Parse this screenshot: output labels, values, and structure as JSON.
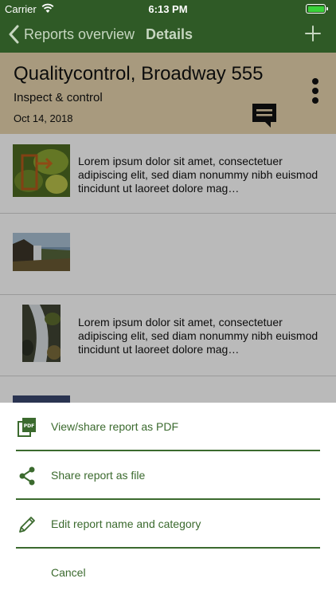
{
  "status_bar": {
    "carrier": "Carrier",
    "time": "6:13 PM",
    "battery_color": "#39d239"
  },
  "nav": {
    "back_label": "Reports overview",
    "title": "Details",
    "add_icon": "plus-icon"
  },
  "report": {
    "title": "Qualitycontrol, Broadway 555",
    "category": "Inspect & control",
    "date": "Oct 14, 2018"
  },
  "entries": [
    {
      "image": "photo-leaf-arrow",
      "text": "Lorem ipsum dolor sit amet, consectetuer adipiscing elit, sed diam nonummy nibh euismod tincidunt ut laoreet dolore mag…"
    },
    {
      "image": "photo-waterfall-landscape",
      "text": ""
    },
    {
      "image": "photo-waterfall-stream",
      "text": "Lorem ipsum dolor sit amet, consectetuer adipiscing elit, sed diam nonummy nibh euismod tincidunt ut laoreet dolore mag…"
    },
    {
      "image": "photo-sunset",
      "text": ""
    }
  ],
  "action_sheet": {
    "items": [
      {
        "label": "View/share report as PDF",
        "icon": "pdf-icon"
      },
      {
        "label": "Share report as file",
        "icon": "share-icon"
      },
      {
        "label": "Edit report name and category",
        "icon": "pencil-icon"
      }
    ],
    "cancel_label": "Cancel"
  },
  "colors": {
    "nav_bar": "#2f5a26",
    "header": "#e6d4ad",
    "accent": "#3b6a2e"
  }
}
